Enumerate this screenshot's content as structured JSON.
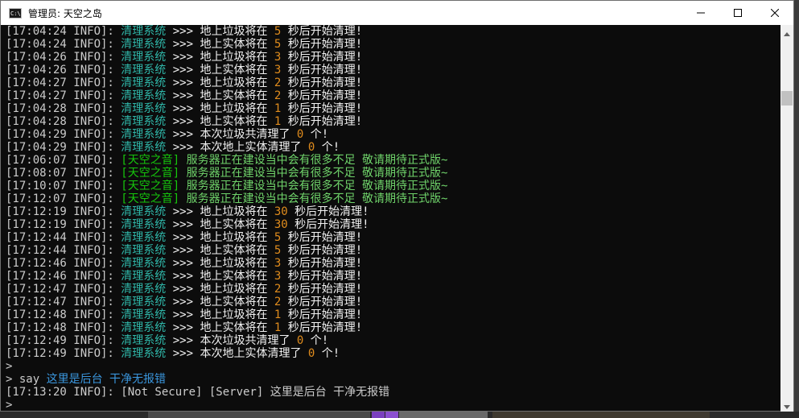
{
  "window": {
    "title": "管理员: 天空之岛",
    "icon_text": "C:\\",
    "controls": [
      "minimize-icon",
      "maximize-icon",
      "close-icon"
    ]
  },
  "colors": {
    "console_bg": "#0c0c0c",
    "timestamp": "#cccccc",
    "system_tag": "#2fb6a8",
    "number": "#e08c1d",
    "broadcast_tag": "#16c60c",
    "broadcast_msg": "#6fd36a",
    "input": "#3a96dd"
  },
  "console": {
    "lines": [
      [
        {
          "t": "[17:04:24 INFO]: ",
          "c": "gray"
        },
        {
          "t": "清理系统",
          "c": "teal"
        },
        {
          "t": " >>> 地上垃圾将在 ",
          "c": "white"
        },
        {
          "t": "5",
          "c": "orange"
        },
        {
          "t": " 秒后开始清理!",
          "c": "white"
        }
      ],
      [
        {
          "t": "[17:04:24 INFO]: ",
          "c": "gray"
        },
        {
          "t": "清理系统",
          "c": "teal"
        },
        {
          "t": " >>> 地上实体将在 ",
          "c": "white"
        },
        {
          "t": "5",
          "c": "orange"
        },
        {
          "t": " 秒后开始清理!",
          "c": "white"
        }
      ],
      [
        {
          "t": "[17:04:26 INFO]: ",
          "c": "gray"
        },
        {
          "t": "清理系统",
          "c": "teal"
        },
        {
          "t": " >>> 地上垃圾将在 ",
          "c": "white"
        },
        {
          "t": "3",
          "c": "orange"
        },
        {
          "t": " 秒后开始清理!",
          "c": "white"
        }
      ],
      [
        {
          "t": "[17:04:26 INFO]: ",
          "c": "gray"
        },
        {
          "t": "清理系统",
          "c": "teal"
        },
        {
          "t": " >>> 地上实体将在 ",
          "c": "white"
        },
        {
          "t": "3",
          "c": "orange"
        },
        {
          "t": " 秒后开始清理!",
          "c": "white"
        }
      ],
      [
        {
          "t": "[17:04:27 INFO]: ",
          "c": "gray"
        },
        {
          "t": "清理系统",
          "c": "teal"
        },
        {
          "t": " >>> 地上垃圾将在 ",
          "c": "white"
        },
        {
          "t": "2",
          "c": "orange"
        },
        {
          "t": " 秒后开始清理!",
          "c": "white"
        }
      ],
      [
        {
          "t": "[17:04:27 INFO]: ",
          "c": "gray"
        },
        {
          "t": "清理系统",
          "c": "teal"
        },
        {
          "t": " >>> 地上实体将在 ",
          "c": "white"
        },
        {
          "t": "2",
          "c": "orange"
        },
        {
          "t": " 秒后开始清理!",
          "c": "white"
        }
      ],
      [
        {
          "t": "[17:04:28 INFO]: ",
          "c": "gray"
        },
        {
          "t": "清理系统",
          "c": "teal"
        },
        {
          "t": " >>> 地上垃圾将在 ",
          "c": "white"
        },
        {
          "t": "1",
          "c": "orange"
        },
        {
          "t": " 秒后开始清理!",
          "c": "white"
        }
      ],
      [
        {
          "t": "[17:04:28 INFO]: ",
          "c": "gray"
        },
        {
          "t": "清理系统",
          "c": "teal"
        },
        {
          "t": " >>> 地上实体将在 ",
          "c": "white"
        },
        {
          "t": "1",
          "c": "orange"
        },
        {
          "t": " 秒后开始清理!",
          "c": "white"
        }
      ],
      [
        {
          "t": "[17:04:29 INFO]: ",
          "c": "gray"
        },
        {
          "t": "清理系统",
          "c": "teal"
        },
        {
          "t": " >>> 本次垃圾共清理了 ",
          "c": "white"
        },
        {
          "t": "0",
          "c": "orange"
        },
        {
          "t": " 个!",
          "c": "white"
        }
      ],
      [
        {
          "t": "[17:04:29 INFO]: ",
          "c": "gray"
        },
        {
          "t": "清理系统",
          "c": "teal"
        },
        {
          "t": " >>> 本次地上实体清理了 ",
          "c": "white"
        },
        {
          "t": "0",
          "c": "orange"
        },
        {
          "t": " 个!",
          "c": "white"
        }
      ],
      [
        {
          "t": "[17:06:07 INFO]: ",
          "c": "gray"
        },
        {
          "t": "[天空之音]",
          "c": "green"
        },
        {
          "t": " 服务器正在建设当中会有很多不足 敬请期待正式版~",
          "c": "lime"
        }
      ],
      [
        {
          "t": "[17:08:07 INFO]: ",
          "c": "gray"
        },
        {
          "t": "[天空之音]",
          "c": "green"
        },
        {
          "t": " 服务器正在建设当中会有很多不足 敬请期待正式版~",
          "c": "lime"
        }
      ],
      [
        {
          "t": "[17:10:07 INFO]: ",
          "c": "gray"
        },
        {
          "t": "[天空之音]",
          "c": "green"
        },
        {
          "t": " 服务器正在建设当中会有很多不足 敬请期待正式版~",
          "c": "lime"
        }
      ],
      [
        {
          "t": "[17:12:07 INFO]: ",
          "c": "gray"
        },
        {
          "t": "[天空之音]",
          "c": "green"
        },
        {
          "t": " 服务器正在建设当中会有很多不足 敬请期待正式版~",
          "c": "lime"
        }
      ],
      [
        {
          "t": "[17:12:19 INFO]: ",
          "c": "gray"
        },
        {
          "t": "清理系统",
          "c": "teal"
        },
        {
          "t": " >>> 地上垃圾将在 ",
          "c": "white"
        },
        {
          "t": "30",
          "c": "orange"
        },
        {
          "t": " 秒后开始清理!",
          "c": "white"
        }
      ],
      [
        {
          "t": "[17:12:19 INFO]: ",
          "c": "gray"
        },
        {
          "t": "清理系统",
          "c": "teal"
        },
        {
          "t": " >>> 地上实体将在 ",
          "c": "white"
        },
        {
          "t": "30",
          "c": "orange"
        },
        {
          "t": " 秒后开始清理!",
          "c": "white"
        }
      ],
      [
        {
          "t": "[17:12:44 INFO]: ",
          "c": "gray"
        },
        {
          "t": "清理系统",
          "c": "teal"
        },
        {
          "t": " >>> 地上垃圾将在 ",
          "c": "white"
        },
        {
          "t": "5",
          "c": "orange"
        },
        {
          "t": " 秒后开始清理!",
          "c": "white"
        }
      ],
      [
        {
          "t": "[17:12:44 INFO]: ",
          "c": "gray"
        },
        {
          "t": "清理系统",
          "c": "teal"
        },
        {
          "t": " >>> 地上实体将在 ",
          "c": "white"
        },
        {
          "t": "5",
          "c": "orange"
        },
        {
          "t": " 秒后开始清理!",
          "c": "white"
        }
      ],
      [
        {
          "t": "[17:12:46 INFO]: ",
          "c": "gray"
        },
        {
          "t": "清理系统",
          "c": "teal"
        },
        {
          "t": " >>> 地上垃圾将在 ",
          "c": "white"
        },
        {
          "t": "3",
          "c": "orange"
        },
        {
          "t": " 秒后开始清理!",
          "c": "white"
        }
      ],
      [
        {
          "t": "[17:12:46 INFO]: ",
          "c": "gray"
        },
        {
          "t": "清理系统",
          "c": "teal"
        },
        {
          "t": " >>> 地上实体将在 ",
          "c": "white"
        },
        {
          "t": "3",
          "c": "orange"
        },
        {
          "t": " 秒后开始清理!",
          "c": "white"
        }
      ],
      [
        {
          "t": "[17:12:47 INFO]: ",
          "c": "gray"
        },
        {
          "t": "清理系统",
          "c": "teal"
        },
        {
          "t": " >>> 地上垃圾将在 ",
          "c": "white"
        },
        {
          "t": "2",
          "c": "orange"
        },
        {
          "t": " 秒后开始清理!",
          "c": "white"
        }
      ],
      [
        {
          "t": "[17:12:47 INFO]: ",
          "c": "gray"
        },
        {
          "t": "清理系统",
          "c": "teal"
        },
        {
          "t": " >>> 地上实体将在 ",
          "c": "white"
        },
        {
          "t": "2",
          "c": "orange"
        },
        {
          "t": " 秒后开始清理!",
          "c": "white"
        }
      ],
      [
        {
          "t": "[17:12:48 INFO]: ",
          "c": "gray"
        },
        {
          "t": "清理系统",
          "c": "teal"
        },
        {
          "t": " >>> 地上垃圾将在 ",
          "c": "white"
        },
        {
          "t": "1",
          "c": "orange"
        },
        {
          "t": " 秒后开始清理!",
          "c": "white"
        }
      ],
      [
        {
          "t": "[17:12:48 INFO]: ",
          "c": "gray"
        },
        {
          "t": "清理系统",
          "c": "teal"
        },
        {
          "t": " >>> 地上实体将在 ",
          "c": "white"
        },
        {
          "t": "1",
          "c": "orange"
        },
        {
          "t": " 秒后开始清理!",
          "c": "white"
        }
      ],
      [
        {
          "t": "[17:12:49 INFO]: ",
          "c": "gray"
        },
        {
          "t": "清理系统",
          "c": "teal"
        },
        {
          "t": " >>> 本次垃圾共清理了 ",
          "c": "white"
        },
        {
          "t": "0",
          "c": "orange"
        },
        {
          "t": " 个!",
          "c": "white"
        }
      ],
      [
        {
          "t": "[17:12:49 INFO]: ",
          "c": "gray"
        },
        {
          "t": "清理系统",
          "c": "teal"
        },
        {
          "t": " >>> 本次地上实体清理了 ",
          "c": "white"
        },
        {
          "t": "0",
          "c": "orange"
        },
        {
          "t": " 个!",
          "c": "white"
        }
      ],
      [
        {
          "t": ">",
          "c": "gray"
        }
      ],
      [
        {
          "t": "> say ",
          "c": "gray"
        },
        {
          "t": "这里是后台 干净无报错",
          "c": "cyan"
        }
      ],
      [
        {
          "t": "[17:13:20 INFO]: [Not Secure] [Server] 这里是后台 干净无报错",
          "c": "gray"
        }
      ],
      [
        {
          "t": ">",
          "c": "gray"
        }
      ]
    ]
  }
}
